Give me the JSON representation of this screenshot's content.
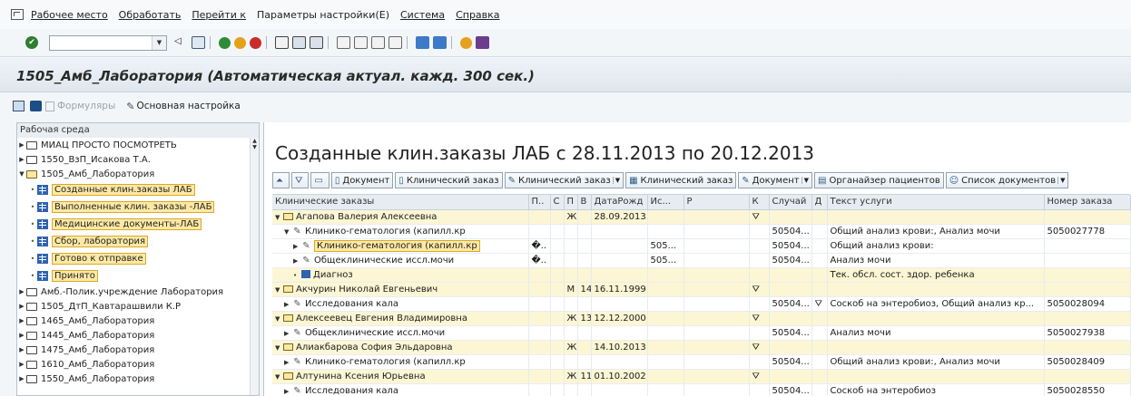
{
  "menu": {
    "items": [
      "Рабочее место",
      "Обработать",
      "Перейти к",
      "Параметры настройки(Е)",
      "Система",
      "Справка"
    ]
  },
  "title": "1505_Амб_Лаборатория (Автоматическая актуал. кажд. 300 сек.)",
  "app_toolbar": {
    "forms": "Формуляры",
    "main_settings": "Основная настройка"
  },
  "tree": {
    "header": "Рабочая среда",
    "items": [
      {
        "label": "МИАЦ ПРОСТО ПОСМОТРЕТЬ"
      },
      {
        "label": "1550_ВзП_Исакова Т.А."
      },
      {
        "label": "1505_Амб_Лаборатория"
      },
      {
        "label": "Созданные клин.заказы ЛАБ"
      },
      {
        "label": "Выполненные клин. заказы -ЛАБ"
      },
      {
        "label": "Медицинские документы-ЛАБ"
      },
      {
        "label": "Сбор, лаборатория"
      },
      {
        "label": "Готово к отправке"
      },
      {
        "label": "Принято"
      },
      {
        "label": "Амб.-Полик.учреждение Лаборатория"
      },
      {
        "label": "1505_ДтП_Кавтарашвили К.Р"
      },
      {
        "label": "1465_Амб_Лаборатория"
      },
      {
        "label": "1445_Амб_Лаборатория"
      },
      {
        "label": "1475_Амб_Лаборатория"
      },
      {
        "label": "1610_Амб_Лаборатория"
      },
      {
        "label": "1550_Амб_Лаборатория"
      }
    ]
  },
  "main": {
    "heading": "Созданные клин.заказы ЛАБ с 28.11.2013 по 20.12.2013",
    "buttons": {
      "document": "Документ",
      "clinical_order": "Клинический заказ",
      "clinical_order_edit": "Клинический заказ",
      "clinical_order_view": "Клинический заказ",
      "document_edit": "Документ",
      "patient_organizer": "Органайзер пациентов",
      "doc_list": "Список документов"
    },
    "columns": [
      "Клинические заказы",
      "П..",
      "С",
      "П",
      "В",
      "ДатаРожд",
      "Ис...",
      "Р",
      "К",
      "Случай",
      "Д",
      "Текст услуги",
      "Номер заказа"
    ],
    "rows": [
      {
        "name": "Агапова Валерия Алексеевна",
        "c2": "",
        "c3": "Ж",
        "c4": "",
        "dob": "28.09.2013",
        "is": "",
        "k": "⛛",
        "case": "",
        "d": "",
        "text": "",
        "order": ""
      },
      {
        "name": "Клинико-гематология (капилл.кр",
        "c2": "",
        "c3": "",
        "c4": "",
        "dob": "",
        "is": "",
        "k": "",
        "case": "50504...",
        "d": "",
        "text": "Общий анализ крови:, Анализ мочи",
        "order": "5050027778"
      },
      {
        "name": "Клинико-гематология (капилл.кр",
        "c2": "�..",
        "c3": "",
        "c4": "",
        "dob": "",
        "is": "505...",
        "k": "",
        "case": "50504...",
        "d": "",
        "text": "Общий анализ крови:",
        "order": ""
      },
      {
        "name": "Общеклинические иссл.мочи",
        "c2": "�..",
        "c3": "",
        "c4": "",
        "dob": "",
        "is": "505...",
        "k": "",
        "case": "50504...",
        "d": "",
        "text": "Анализ мочи",
        "order": ""
      },
      {
        "name": "Диагноз",
        "c2": "",
        "c3": "",
        "c4": "",
        "dob": "",
        "is": "",
        "k": "",
        "case": "",
        "d": "",
        "text": "Тек. обсл. сост. здор. ребенка",
        "order": ""
      },
      {
        "name": "Акчурин Николай Евгеньевич",
        "c2": "",
        "c3": "М",
        "c4": "14",
        "dob": "16.11.1999",
        "is": "",
        "k": "⛛",
        "case": "",
        "d": "",
        "text": "",
        "order": ""
      },
      {
        "name": "Исследования кала",
        "c2": "",
        "c3": "",
        "c4": "",
        "dob": "",
        "is": "",
        "k": "",
        "case": "50504...",
        "d": "⛛",
        "text": "Соскоб на энтеробиоз, Общий анализ кр...",
        "order": "5050028094"
      },
      {
        "name": "Алексеевец Евгения Владимировна",
        "c2": "",
        "c3": "Ж",
        "c4": "13",
        "dob": "12.12.2000",
        "is": "",
        "k": "⛛",
        "case": "",
        "d": "",
        "text": "",
        "order": ""
      },
      {
        "name": "Общеклинические иссл.мочи",
        "c2": "",
        "c3": "",
        "c4": "",
        "dob": "",
        "is": "",
        "k": "",
        "case": "50504...",
        "d": "",
        "text": "Анализ мочи",
        "order": "5050027938"
      },
      {
        "name": "Алиакбарова София Эльдаровна",
        "c2": "",
        "c3": "Ж",
        "c4": "",
        "dob": "14.10.2013",
        "is": "",
        "k": "⛛",
        "case": "",
        "d": "",
        "text": "",
        "order": ""
      },
      {
        "name": "Клинико-гематология (капилл.кр",
        "c2": "",
        "c3": "",
        "c4": "",
        "dob": "",
        "is": "",
        "k": "",
        "case": "50504...",
        "d": "",
        "text": "Общий анализ крови:, Анализ мочи",
        "order": "5050028409"
      },
      {
        "name": "Алтунина Ксения Юрьевна",
        "c2": "",
        "c3": "Ж",
        "c4": "11",
        "dob": "01.10.2002",
        "is": "",
        "k": "⛛",
        "case": "",
        "d": "",
        "text": "",
        "order": ""
      },
      {
        "name": "Исследования кала",
        "c2": "",
        "c3": "",
        "c4": "",
        "dob": "",
        "is": "",
        "k": "",
        "case": "50504...",
        "d": "",
        "text": "Соскоб на энтеробиоз",
        "order": "5050028550"
      }
    ]
  },
  "colors": {
    "highlight": "#fde9a4",
    "row_yellow": "#fcf6d4",
    "header_bg": "#e6ecf1",
    "title_bg": "#dfe7ee"
  }
}
